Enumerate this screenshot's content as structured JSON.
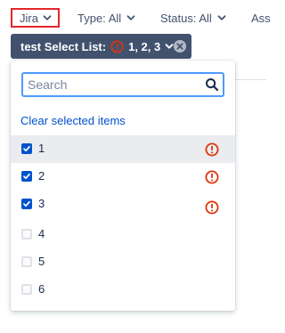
{
  "filters": {
    "project": "Jira",
    "type": "Type: All",
    "status": "Status: All",
    "assignee_truncated": "Ass"
  },
  "active_filter": {
    "label": "test Select List:",
    "values": "1, 2, 3"
  },
  "dropdown": {
    "search_placeholder": "Search",
    "clear_label": "Clear selected items",
    "options": [
      {
        "label": "1",
        "checked": true,
        "warning": true
      },
      {
        "label": "2",
        "checked": true,
        "warning": true
      },
      {
        "label": "3",
        "checked": true,
        "warning": true
      },
      {
        "label": "4",
        "checked": false,
        "warning": false
      },
      {
        "label": "5",
        "checked": false,
        "warning": false
      },
      {
        "label": "6",
        "checked": false,
        "warning": false
      }
    ]
  },
  "colors": {
    "accent": "#0052cc",
    "pill_bg": "#42526e",
    "warning": "#de350b",
    "highlight_border": "#e5262a",
    "focus_border": "#4c9aff"
  },
  "icons": {
    "chevron": "chevron-down-icon",
    "warning": "warning-icon",
    "search": "search-icon",
    "close": "close-icon",
    "check": "checkmark-icon"
  }
}
